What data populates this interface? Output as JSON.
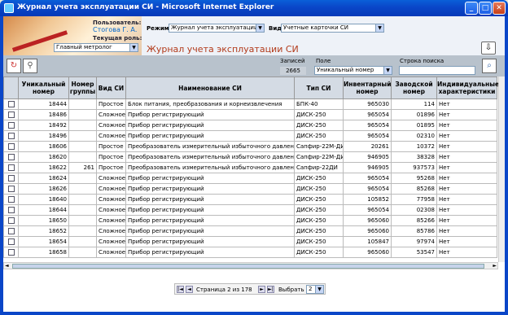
{
  "window": {
    "title": "Журнал учета эксплуатации СИ - Microsoft Internet Explorer",
    "min_symbol": "_",
    "max_symbol": "□",
    "close_symbol": "✕"
  },
  "header": {
    "user_label": "Пользователь:",
    "user_name": "Стогова Г. А.",
    "role_label": "Текущая роль:",
    "role_value": "Главный метролог",
    "mode_label": "Режим:",
    "mode_value": "Журнал учета эксплуатации",
    "view_label": "Вид:",
    "view_value": "Учетные карточки СИ",
    "page_title": "Журнал учета эксплуатации СИ"
  },
  "toolbar": {
    "records_label": "Записей",
    "records_count": "2665",
    "field_label": "Поле",
    "field_value": "Уникальный номер",
    "search_label": "Строка поиска",
    "search_value": ""
  },
  "table": {
    "columns": [
      "",
      "Уникальный номер",
      "Номер группы",
      "Вид СИ",
      "Наименование СИ",
      "Тип СИ",
      "Инвентарный номер",
      "Заводской номер",
      "Индивидуальные характеристики"
    ],
    "rows": [
      [
        "18444",
        "",
        "Простое",
        "Блок питания, преобразования и корнеизвлечения",
        "БПК-40",
        "965030",
        "114",
        "Нет"
      ],
      [
        "18486",
        "",
        "Сложное",
        "Прибор регистрирующий",
        "ДИСК-250",
        "965054",
        "01896",
        "Нет"
      ],
      [
        "18492",
        "",
        "Сложное",
        "Прибор регистрирующий",
        "ДИСК-250",
        "965054",
        "01895",
        "Нет"
      ],
      [
        "18496",
        "",
        "Сложное",
        "Прибор регистрирующий",
        "ДИСК-250",
        "965054",
        "02310",
        "Нет"
      ],
      [
        "18606",
        "",
        "Простое",
        "Преобразователь измерительный избыточного давления",
        "Сапфир-22М-ДИ",
        "20261",
        "10372",
        "Нет"
      ],
      [
        "18620",
        "",
        "Простое",
        "Преобразователь измерительный избыточного давления",
        "Сапфир-22М-ДИ",
        "946905",
        "38328",
        "Нет"
      ],
      [
        "18622",
        "261",
        "Простое",
        "Преобразователь измерительный избыточного давления",
        "Сапфир-22ДИ",
        "946905",
        "937573",
        "Нет"
      ],
      [
        "18624",
        "",
        "Сложное",
        "Прибор регистрирующий",
        "ДИСК-250",
        "965054",
        "95268",
        "Нет"
      ],
      [
        "18626",
        "",
        "Сложное",
        "Прибор регистрирующий",
        "ДИСК-250",
        "965054",
        "85268",
        "Нет"
      ],
      [
        "18640",
        "",
        "Сложное",
        "Прибор регистрирующий",
        "ДИСК-250",
        "105852",
        "77958",
        "Нет"
      ],
      [
        "18644",
        "",
        "Сложное",
        "Прибор регистрирующий",
        "ДИСК-250",
        "965054",
        "02308",
        "Нет"
      ],
      [
        "18650",
        "",
        "Сложное",
        "Прибор регистрирующий",
        "ДИСК-250",
        "965060",
        "85266",
        "Нет"
      ],
      [
        "18652",
        "",
        "Сложное",
        "Прибор регистрирующий",
        "ДИСК-250",
        "965060",
        "85786",
        "Нет"
      ],
      [
        "18654",
        "",
        "Сложное",
        "Прибор регистрирующий",
        "ДИСК-250",
        "105847",
        "97974",
        "Нет"
      ],
      [
        "18658",
        "",
        "Сложное",
        "Прибор регистрирующий",
        "ДИСК-250",
        "965060",
        "53547",
        "Нет"
      ]
    ]
  },
  "pager": {
    "first": "|◄",
    "prev": "◄",
    "page_text": "Страница 2 из 178",
    "next": "►",
    "last": "►|",
    "select_label": "Выбрать",
    "select_value": "2"
  }
}
